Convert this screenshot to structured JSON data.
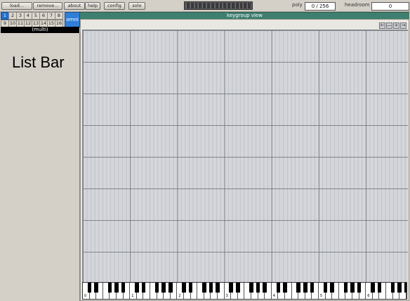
{
  "toolbar": {
    "load_label": "load...",
    "remove_label": "remove...",
    "about_label": "about",
    "help_label": "help",
    "config_label": "config",
    "solo_label": "solo",
    "poly_label": "poly",
    "poly_value": "0 / 256",
    "headroom_label": "headroom",
    "headroom_value": "0"
  },
  "channels": {
    "row1": [
      "1",
      "2",
      "3",
      "4",
      "5",
      "6",
      "7",
      "8"
    ],
    "row2": [
      "9",
      "10",
      "11",
      "12",
      "13",
      "14",
      "15",
      "16"
    ],
    "selected": "1",
    "omni_label": "omni",
    "multi_label": "(multi)"
  },
  "listbar": {
    "title": "List Bar"
  },
  "keygroup": {
    "title": "keygroup view",
    "nav": [
      "←",
      "—",
      "+",
      "→"
    ],
    "octave_labels": [
      "0",
      "1",
      "2",
      "3",
      "4",
      "5",
      "6"
    ]
  }
}
